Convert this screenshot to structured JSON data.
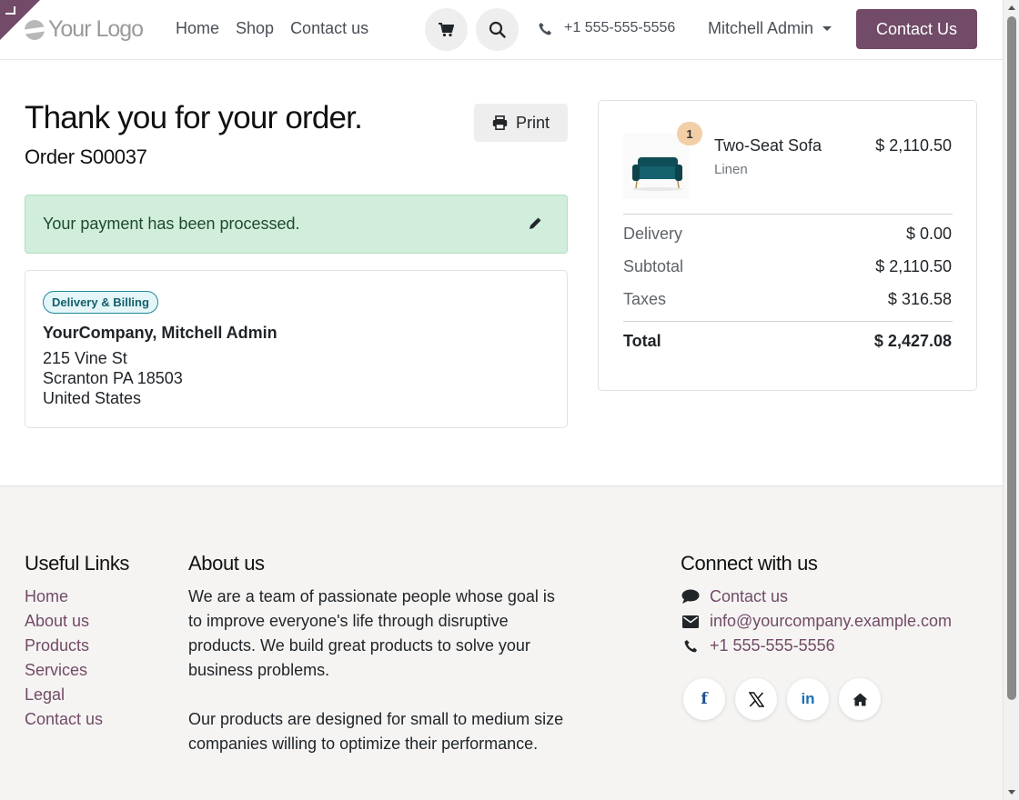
{
  "header": {
    "logo_text": "Your Logo",
    "nav": [
      "Home",
      "Shop",
      "Contact us"
    ],
    "phone": "+1 555-555-5556",
    "user_name": "Mitchell Admin",
    "cta_label": "Contact Us"
  },
  "main": {
    "title": "Thank you for your order.",
    "order_number": "Order S00037",
    "print_label": "Print",
    "payment_message": "Your payment has been processed.",
    "address": {
      "badge": "Delivery & Billing",
      "name": "YourCompany, Mitchell Admin",
      "street": "215 Vine St",
      "city_line": "Scranton PA 18503",
      "country": "United States"
    }
  },
  "summary": {
    "product": {
      "name": "Two-Seat Sofa",
      "variant": "Linen",
      "price": "$ 2,110.50",
      "quantity": "1"
    },
    "rows": [
      {
        "label": "Delivery",
        "value": "$ 0.00"
      },
      {
        "label": "Subtotal",
        "value": "$ 2,110.50"
      },
      {
        "label": "Taxes",
        "value": "$ 316.58"
      }
    ],
    "total_label": "Total",
    "total_value": "$ 2,427.08"
  },
  "footer": {
    "useful_links_title": "Useful Links",
    "links": [
      "Home",
      "About us",
      "Products",
      "Services",
      "Legal",
      "Contact us"
    ],
    "about_title": "About us",
    "about_p1": "We are a team of passionate people whose goal is to improve everyone's life through disruptive products. We build great products to solve your business problems.",
    "about_p2": "Our products are designed for small to medium size companies willing to optimize their performance.",
    "connect_title": "Connect with us",
    "contact_us": "Contact us",
    "email": "info@yourcompany.example.com",
    "phone": "+1 555-555-5556",
    "social": [
      "f",
      "in"
    ]
  },
  "colors": {
    "brand": "#714b67",
    "alert_bg": "#d1eddb",
    "footer_bg": "#f5f4f2"
  }
}
